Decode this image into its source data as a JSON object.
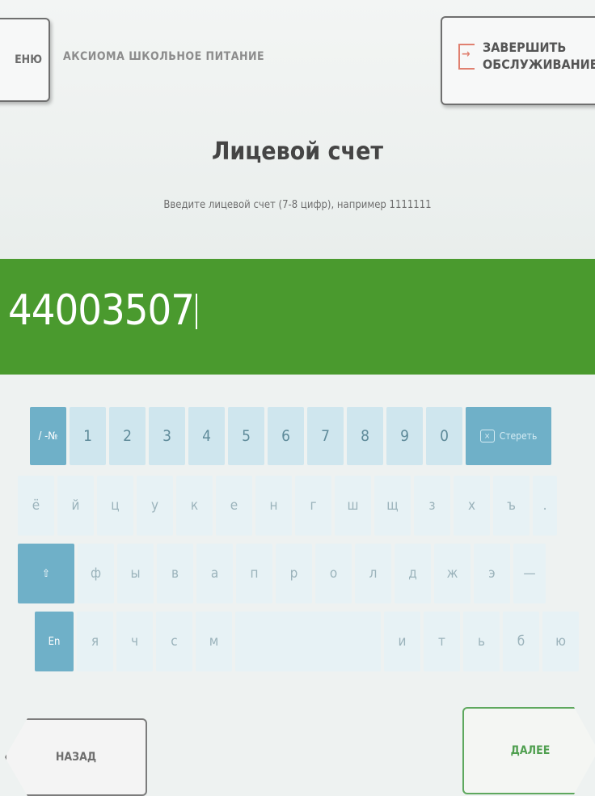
{
  "header": {
    "menu_label": "ЕНЮ",
    "app_title": "АКСИОМА ШКОЛЬНОЕ ПИТАНИЕ",
    "finish_label": "ЗАВЕРШИТЬ\nОБСЛУЖИВАНИЕ"
  },
  "page": {
    "title": "Лицевой счет",
    "hint": "Введите лицевой счет (7-8 цифр), например 1111111"
  },
  "input": {
    "value": "44003507"
  },
  "keyboard": {
    "row1": [
      "/ -№",
      "1",
      "2",
      "3",
      "4",
      "5",
      "6",
      "7",
      "8",
      "9",
      "0"
    ],
    "delete_label": "Стереть",
    "row2": [
      "ё",
      "й",
      "ц",
      "у",
      "к",
      "е",
      "н",
      "г",
      "ш",
      "щ",
      "з",
      "х",
      "ъ",
      "."
    ],
    "row3": [
      "⇧",
      "ф",
      "ы",
      "в",
      "а",
      "п",
      "р",
      "о",
      "л",
      "д",
      "ж",
      "э",
      "—"
    ],
    "row4": [
      "En",
      "я",
      "ч",
      "с",
      "м",
      "",
      "и",
      "т",
      "ь",
      "б",
      "ю"
    ]
  },
  "nav": {
    "back_label": "НАЗАД",
    "next_label": "ДАЛЕЕ"
  },
  "colors": {
    "accent_green": "#4a9a2e",
    "key_blue": "#6fb0c8"
  }
}
